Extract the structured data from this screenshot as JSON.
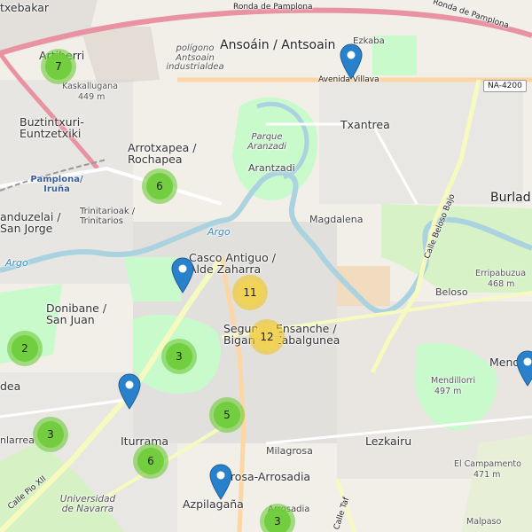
{
  "map": {
    "labels": {
      "ansoain": "Ansoáin / Antsoain",
      "ezkaba": "Ezkaba",
      "avenida_villava": "Avenida Villava",
      "na4200": "NA-4200",
      "txantrea": "Txantrea",
      "burlada": "Burlad",
      "buztintxuri": "Buztintxuri-Euntzetxiki",
      "artiberri": "Artiberri",
      "kaskalluga": "Kaskalluganа",
      "kaskalluga_ele": "449 m",
      "poligono": "polígono Antsoain industrialdea",
      "ronda1": "Ronda de Pamplona",
      "ronda2": "Ronda de Pamplona",
      "txebakar": "txebakar",
      "arrotxapea": "Arrotxapea / Rochapea",
      "parque_aranzadi": "Parque Aranzadi",
      "arantzadi": "Arantzadi",
      "pamplona_iruna": "Pamplona/ Iruña",
      "anduzelai": "anduzelai / San Jorge",
      "trinitarioak": "Trinitarioak / Trinitarios",
      "magdalena": "Magdalena",
      "argo1": "Argo",
      "argo2": "Argo",
      "casco": "Casco Antiguo / Alde Zaharra",
      "donibane": "Donibane / San Juan",
      "segundo": "Segundo Ensanche / Bigarren Zabalgunea",
      "beloso": "Beloso",
      "calle_beloso": "Calle Beloso Bajo",
      "erripabuzua": "Erripabuzua",
      "erripabuzua_ele": "468 m",
      "mendillorri": "Mendillorri",
      "mendillorri_ele": "497 m",
      "mendi": "Mend",
      "iturrama": "Iturrama",
      "milagrosa": "Milagrosa",
      "lezkairu": "Lezkairu",
      "arrosadia": "grosa-Arrosadia",
      "azpilagana": "Azpilagaña",
      "arrosadia2": "Arrosadia",
      "el_campamento": "El Campamento",
      "el_campamento_ele": "471 m",
      "malpaso": "Malpaso",
      "univ_navarra": "Universidad de Navarra",
      "nlarrea": "nlarrea",
      "calle_pio": "Calle Pio XII",
      "calle_tafalla": "Calle Taf",
      "dea": "dea"
    },
    "clusters": [
      {
        "count": "7",
        "color": "green"
      },
      {
        "count": "6",
        "color": "green"
      },
      {
        "count": "11",
        "color": "yellow"
      },
      {
        "count": "12",
        "color": "yellow"
      },
      {
        "count": "2",
        "color": "green"
      },
      {
        "count": "3",
        "color": "green"
      },
      {
        "count": "3",
        "color": "green"
      },
      {
        "count": "5",
        "color": "green"
      },
      {
        "count": "6",
        "color": "green"
      },
      {
        "count": "3",
        "color": "green"
      }
    ],
    "colors": {
      "marker": "#2a81cb",
      "cluster_green": "#6ecc39",
      "cluster_yellow": "#f0c20c",
      "park": "#c8facc",
      "water": "#aad3df",
      "motorway": "#e892a2",
      "primary": "#fcd6a4",
      "secondary": "#f7fabf"
    }
  }
}
